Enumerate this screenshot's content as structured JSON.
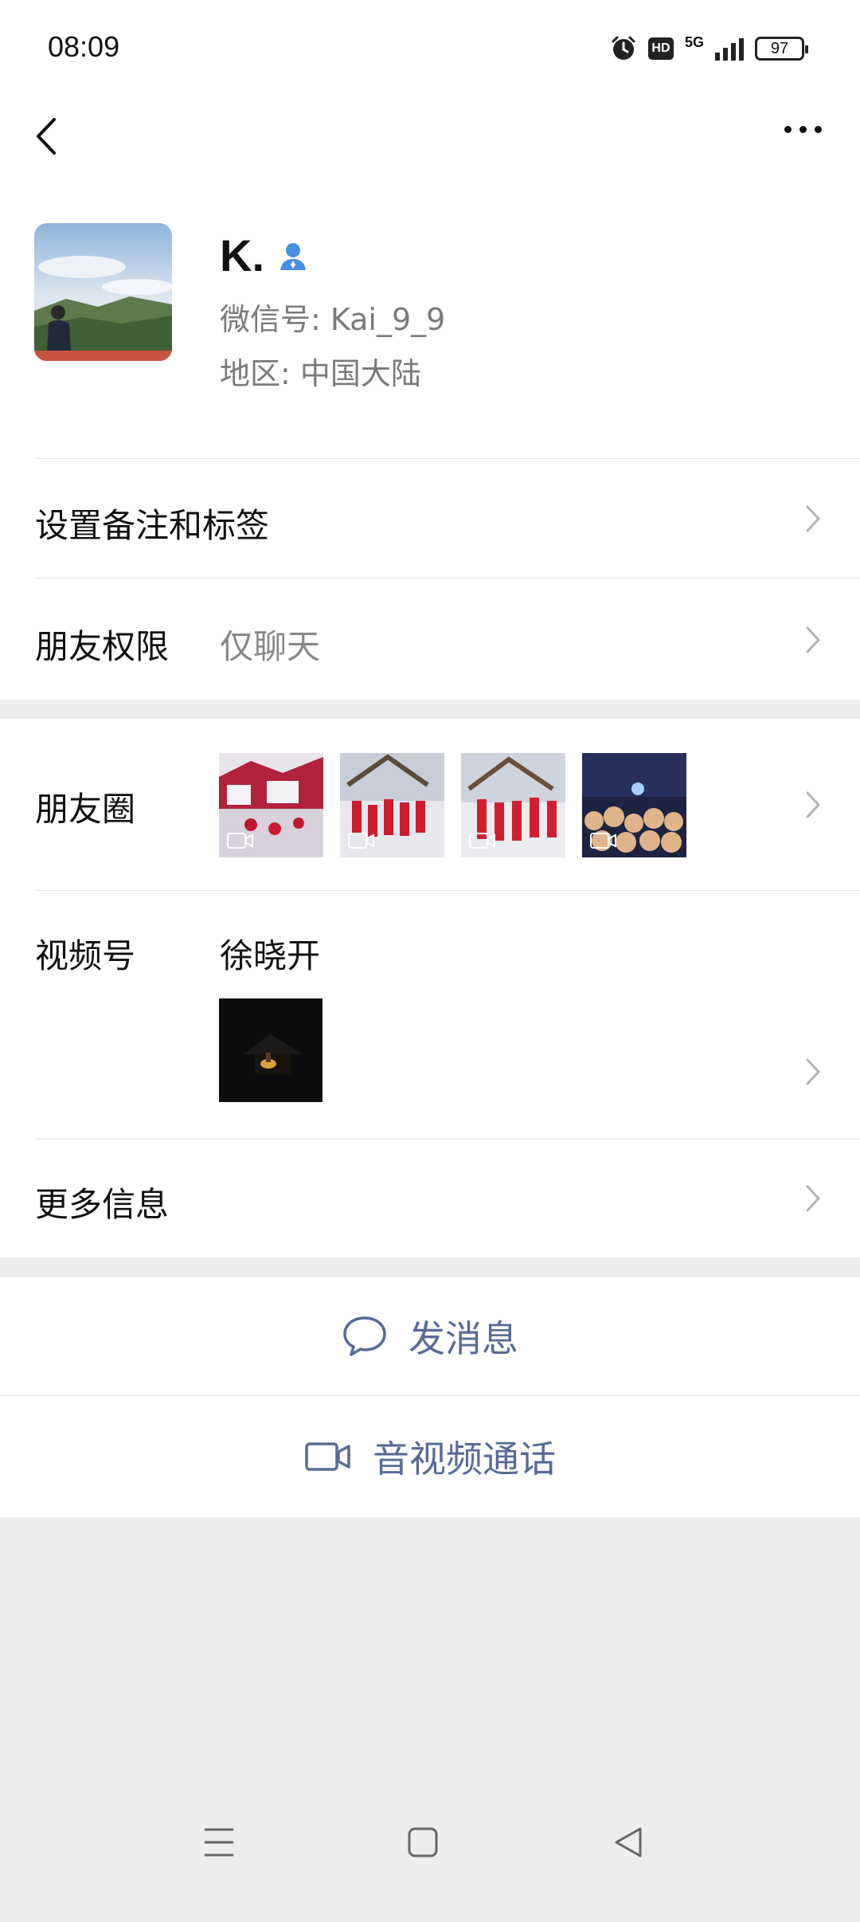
{
  "status_bar": {
    "time": "08:09",
    "hd_label": "HD",
    "network": "5G",
    "battery": "97"
  },
  "nav": {
    "back_icon": "chevron-left-icon",
    "more_icon": "more-dots-icon"
  },
  "profile": {
    "name": "K.",
    "wechat_id": "微信号: Kai_9_9",
    "region": "地区: 中国大陆",
    "badge_icon": "person-icon",
    "badge_color": "#4a90e2"
  },
  "menu": {
    "remark_label": "设置备注和标签",
    "permission_label": "朋友权限",
    "permission_value": "仅聊天",
    "moments_label": "朋友圈",
    "channels_label": "视频号",
    "channels_name": "徐晓开",
    "more_info_label": "更多信息"
  },
  "actions": {
    "message_label": "发消息",
    "call_label": "音视频通话",
    "accent_color": "#576b95"
  }
}
